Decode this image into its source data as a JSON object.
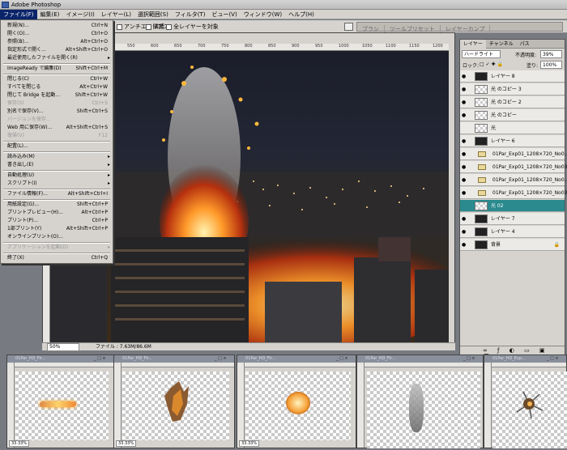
{
  "titlebar": {
    "title": "Adobe Photoshop"
  },
  "menubar": {
    "items": [
      "ファイル(F)",
      "編集(E)",
      "イメージ(I)",
      "レイヤー(L)",
      "選択範囲(S)",
      "フィルタ(T)",
      "ビュー(V)",
      "ウィンドウ(W)",
      "ヘルプ(H)"
    ]
  },
  "options": {
    "antialias": "アンチエイリアス",
    "contiguous": "隣接",
    "all_layers": "全レイヤーを対象",
    "tabs": [
      "ブラシ",
      "ツールプリセット",
      "レイヤーカンプ"
    ]
  },
  "file_menu": {
    "items": [
      {
        "label": "新規(N)...",
        "key": "Ctrl+N"
      },
      {
        "label": "開く(O)...",
        "key": "Ctrl+O"
      },
      {
        "label": "参照(B)...",
        "key": "Alt+Ctrl+O"
      },
      {
        "label": "指定形式で開く...",
        "key": "Alt+Shift+Ctrl+O"
      },
      {
        "label": "最近使用したファイルを開く(R)",
        "key": ""
      },
      {
        "label": "ImageReady で編集(D)",
        "key": "Shift+Ctrl+M"
      },
      {
        "label": "閉じる(C)",
        "key": "Ctrl+W"
      },
      {
        "label": "すべてを閉じる",
        "key": "Alt+Ctrl+W"
      },
      {
        "label": "閉じて Bridge を起動...",
        "key": "Shift+Ctrl+W"
      },
      {
        "label": "保存(S)",
        "key": "Ctrl+S"
      },
      {
        "label": "別名で保存(V)...",
        "key": "Shift+Ctrl+S"
      },
      {
        "label": "バージョンを保存...",
        "key": ""
      },
      {
        "label": "Web 用に保存(W)...",
        "key": "Alt+Shift+Ctrl+S"
      },
      {
        "label": "復帰(V)",
        "key": "F12"
      },
      {
        "label": "配置(L)...",
        "key": ""
      },
      {
        "label": "読み込み(M)",
        "key": ""
      },
      {
        "label": "書き出し(E)",
        "key": ""
      },
      {
        "label": "自動処理(U)",
        "key": ""
      },
      {
        "label": "スクリプト(I)",
        "key": ""
      },
      {
        "label": "ファイル情報(F)...",
        "key": "Alt+Shift+Ctrl+I"
      },
      {
        "label": "用紙設定(G)...",
        "key": "Shift+Ctrl+P"
      },
      {
        "label": "プリントプレビュー(H)...",
        "key": "Alt+Ctrl+P"
      },
      {
        "label": "プリント(P)...",
        "key": "Ctrl+P"
      },
      {
        "label": "1部プリント(Y)",
        "key": "Alt+Shift+Ctrl+P"
      },
      {
        "label": "オンラインプリント(O)...",
        "key": ""
      },
      {
        "label": "アプリケーションを起動(D)",
        "key": ""
      },
      {
        "label": "終了(X)",
        "key": "Ctrl+Q"
      }
    ]
  },
  "document": {
    "status": "ファイル : 7.63M/86.6M",
    "zoom": "50%",
    "ruler": [
      "400",
      "450",
      "500",
      "550",
      "600",
      "650",
      "700",
      "750",
      "800",
      "850",
      "900",
      "950",
      "1000",
      "1050",
      "1100",
      "1150",
      "1200"
    ]
  },
  "layers_panel": {
    "tabs": [
      "レイヤー",
      "チャンネル",
      "パス"
    ],
    "blend": "ハードライト",
    "opacity_label": "不透明度:",
    "opacity": "39%",
    "lock_label": "ロック:",
    "fill_label": "塗り:",
    "fill": "100%",
    "layers": [
      {
        "name": "レイヤー 8",
        "thumb": "checker"
      },
      {
        "name": "光 のコピー 3",
        "thumb": "checker"
      },
      {
        "name": "光 のコピー 2",
        "thumb": "checker"
      },
      {
        "name": "光 のコピー",
        "thumb": "checker"
      },
      {
        "name": "光",
        "thumb": "checker"
      },
      {
        "name": "レイヤー 6",
        "thumb": "dark"
      },
      {
        "name": "01Par_Exp01_1208×720_No0...",
        "thumb": "folder"
      },
      {
        "name": "01Par_Exp01_1208×720_No03...",
        "thumb": "folder"
      },
      {
        "name": "01Par_Exp01_1208×720_No0...",
        "thumb": "folder"
      },
      {
        "name": "01Par_Exp01_1208×720_No03...",
        "thumb": "folder"
      },
      {
        "name": "光 02",
        "thumb": "checker"
      },
      {
        "name": "レイヤー 7",
        "thumb": "dark"
      },
      {
        "name": "レイヤー 4",
        "thumb": "dark"
      },
      {
        "name": "背景",
        "thumb": "dark"
      }
    ]
  },
  "thumb_windows": [
    {
      "title": "01Par_HD_Fir...",
      "zoom": "33.33%"
    },
    {
      "title": "01Par_HD_Fir...",
      "zoom": "33.33%"
    },
    {
      "title": "01Par_HD_Fir...",
      "zoom": "33.33%"
    },
    {
      "title": "01Par_HD_Fir...",
      "zoom": ""
    },
    {
      "title": "01Par_HD_Exp...",
      "zoom": ""
    }
  ],
  "colors": {
    "selected_layer": "#2a8a8e",
    "menu_highlight": "#0a246a",
    "panel_bg": "#d6d3ce"
  }
}
